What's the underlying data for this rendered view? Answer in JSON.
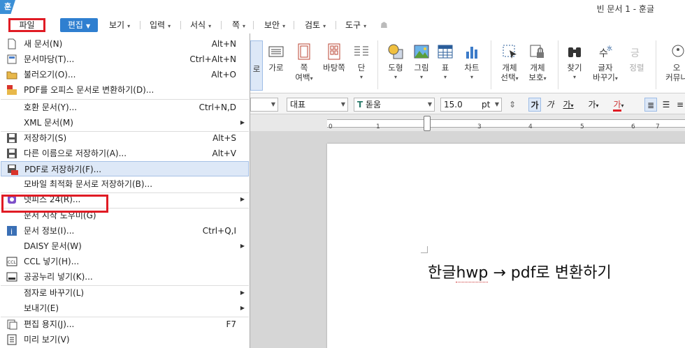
{
  "window": {
    "logo": "훈",
    "title": "빈 문서 1 - 훈글"
  },
  "menubar": {
    "file": "파일",
    "edit": "편집",
    "items": [
      "보기",
      "입력",
      "서식",
      "쪽",
      "보안",
      "검토",
      "도구"
    ]
  },
  "ribbon": {
    "buttons": [
      {
        "label": "로",
        "icon": "partial-icon"
      },
      {
        "label": "가로",
        "icon": "landscape-icon"
      },
      {
        "label": "쪽",
        "label2": "여백",
        "icon": "page-margin-icon"
      },
      {
        "label": "바탕쪽",
        "icon": "master-page-icon"
      },
      {
        "label": "단",
        "icon": "columns-icon"
      },
      {
        "label": "도형",
        "icon": "shape-icon"
      },
      {
        "label": "그림",
        "icon": "picture-icon"
      },
      {
        "label": "표",
        "icon": "table-icon"
      },
      {
        "label": "차트",
        "icon": "chart-icon"
      },
      {
        "label": "개체",
        "label2": "선택",
        "icon": "object-select-icon"
      },
      {
        "label": "개체",
        "label2": "보호",
        "icon": "object-protect-icon"
      },
      {
        "label": "찾기",
        "icon": "find-icon"
      },
      {
        "label": "글자",
        "label2": "바꾸기",
        "icon": "replace-icon"
      },
      {
        "label": "정렬",
        "icon": "sort-icon"
      },
      {
        "label": "오",
        "label2": "커뮤니",
        "icon": "community-icon"
      }
    ]
  },
  "format": {
    "style": "대표",
    "font": "돋움",
    "font_prefix": "T",
    "size": "15.0",
    "unit": "pt",
    "bold": "가",
    "italic": "가",
    "underline": "가",
    "strike": "가",
    "color": "가"
  },
  "ruler": {
    "numbers": [
      "1",
      "2",
      "3",
      "4",
      "5",
      "6",
      "7"
    ],
    "start": "0"
  },
  "document": {
    "text_prefix": "한글",
    "text_squiggly": "hwp",
    "text_suffix": " → pdf로 변환하기"
  },
  "file_menu": {
    "items": [
      {
        "label": "새 문서(N)",
        "shortcut": "Alt+N",
        "icon": "new-document-icon"
      },
      {
        "label": "문서마당(T)...",
        "shortcut": "Ctrl+Alt+N",
        "icon": "document-template-icon"
      },
      {
        "label": "불러오기(O)...",
        "shortcut": "Alt+O",
        "icon": "open-folder-icon"
      },
      {
        "label": "PDF를 오피스 문서로 변환하기(D)...",
        "shortcut": "",
        "icon": "pdf-convert-icon"
      },
      {
        "label": "호환 문서(Y)...",
        "shortcut": "Ctrl+N,D",
        "icon": ""
      },
      {
        "label": "XML 문서(M)",
        "shortcut": "",
        "icon": ""
      },
      {
        "label": "저장하기(S)",
        "shortcut": "Alt+S",
        "icon": "save-icon"
      },
      {
        "label": "다른 이름으로 저장하기(A)...",
        "shortcut": "Alt+V",
        "icon": "save-as-icon"
      },
      {
        "label": "PDF로 저장하기(F)...",
        "shortcut": "",
        "icon": "save-pdf-icon"
      },
      {
        "label": "모바일 최적화 문서로 저장하기(B)...",
        "shortcut": "",
        "icon": ""
      },
      {
        "label": "넷피스 24(R)...",
        "shortcut": "",
        "icon": "netffice-icon"
      },
      {
        "label": "문서 시작 도우미(G)",
        "shortcut": "",
        "icon": ""
      },
      {
        "label": "문서 정보(I)...",
        "shortcut": "Ctrl+Q,I",
        "icon": "info-icon"
      },
      {
        "label": "DAISY 문서(W)",
        "shortcut": "",
        "icon": ""
      },
      {
        "label": "CCL 넣기(H)...",
        "shortcut": "",
        "icon": "ccl-icon"
      },
      {
        "label": "공공누리 넣기(K)...",
        "shortcut": "",
        "icon": "open-license-icon"
      },
      {
        "label": "점자로 바꾸기(L)",
        "shortcut": "",
        "icon": ""
      },
      {
        "label": "보내기(E)",
        "shortcut": "",
        "icon": ""
      },
      {
        "label": "편집 용지(J)...",
        "shortcut": "F7",
        "icon": "page-setup-icon"
      },
      {
        "label": "미리 보기(V)",
        "shortcut": "",
        "icon": "preview-icon"
      }
    ]
  },
  "colors": {
    "accent": "#2f7fd0",
    "highlight": "#e01b24",
    "menu_hover": "#dde8f7"
  }
}
